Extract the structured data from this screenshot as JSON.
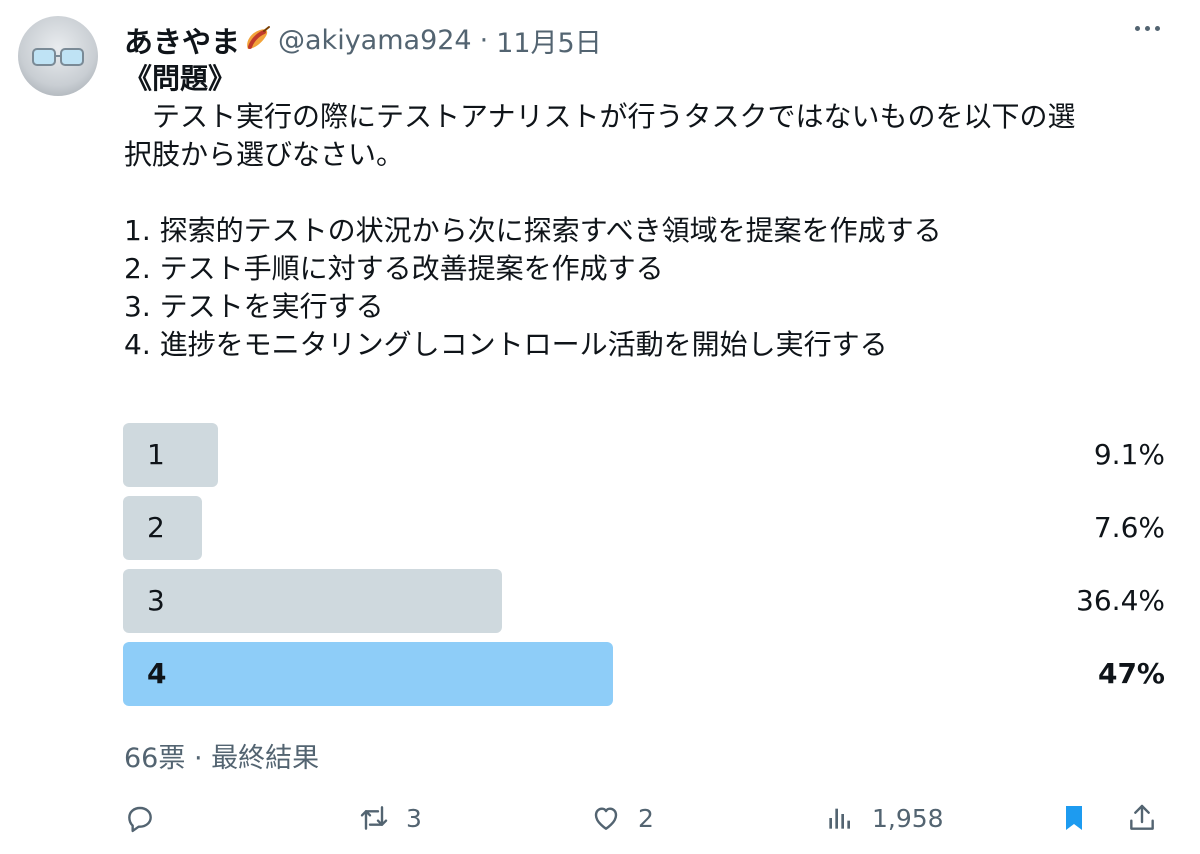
{
  "author": {
    "name": "あきやま",
    "handle": "@akiyama924",
    "separator": "·",
    "date": "11月5日"
  },
  "post": {
    "title": "《問題》",
    "paragraph_1": "　テスト実行の際にテストアナリストが行うタスクではないものを以下の選",
    "paragraph_2": "択肢から選びなさい。",
    "options": [
      "1. 探索的テストの状況から次に探索すべき領域を提案を作成する",
      "2. テスト手順に対する改善提案を作成する",
      "3. テストを実行する",
      "4. 進捗をモニタリングしコントロール活動を開始し実行する"
    ]
  },
  "poll": {
    "choices": [
      {
        "label": "1",
        "percent_text": "9.1%",
        "fraction": 0.091,
        "winner": false
      },
      {
        "label": "2",
        "percent_text": "7.6%",
        "fraction": 0.076,
        "winner": false
      },
      {
        "label": "3",
        "percent_text": "36.4%",
        "fraction": 0.364,
        "winner": false
      },
      {
        "label": "4",
        "percent_text": "47%",
        "fraction": 0.47,
        "winner": true
      }
    ],
    "summary": "66票 · 最終結果"
  },
  "actions": {
    "reply_count": "",
    "repost_count": "3",
    "like_count": "2",
    "views_count": "1,958"
  },
  "colors": {
    "bar": "#cfd9de",
    "winner_bar": "#8ecdf8",
    "bookmark": "#1d9bf0",
    "secondary_text": "#536471"
  },
  "icons": [
    "reply-icon",
    "repost-icon",
    "like-icon",
    "views-icon",
    "bookmark-icon",
    "share-icon",
    "more-icon"
  ]
}
